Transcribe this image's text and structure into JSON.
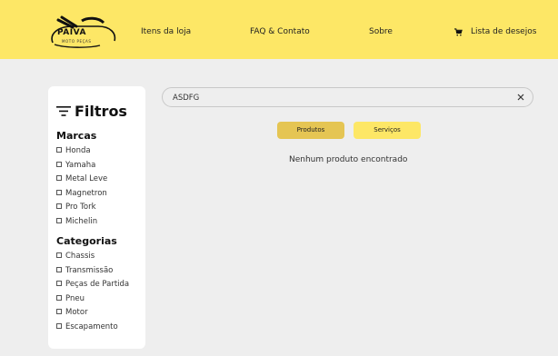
{
  "brand": {
    "name": "PAIVA",
    "subtitle": "MOTO PEÇAS",
    "accent": "#fde766",
    "accent_dark": "#e5c553"
  },
  "header": {
    "nav": [
      {
        "label": "Itens da loja"
      },
      {
        "label": "FAQ & Contato"
      },
      {
        "label": "Sobre"
      },
      {
        "label": "Lista de desejos",
        "icon": "cart-icon"
      }
    ]
  },
  "sidebar": {
    "title": "Filtros",
    "title_icon": "filter-icon",
    "brands_title": "Marcas",
    "brands": [
      "Honda",
      "Yamaha",
      "Metal Leve",
      "Magnetron",
      "Pro Tork",
      "Michelin"
    ],
    "categories_title": "Categorias",
    "categories": [
      "Chassis",
      "Transmissão",
      "Peças de Partida",
      "Pneu",
      "Motor",
      "Escapamento"
    ]
  },
  "search": {
    "value": "ASDFG",
    "clear_icon": "close-icon"
  },
  "tabs": [
    {
      "label": "Produtos",
      "selected": true
    },
    {
      "label": "Serviços",
      "selected": false
    }
  ],
  "results": {
    "empty_message": "Nenhum produto encontrado"
  }
}
